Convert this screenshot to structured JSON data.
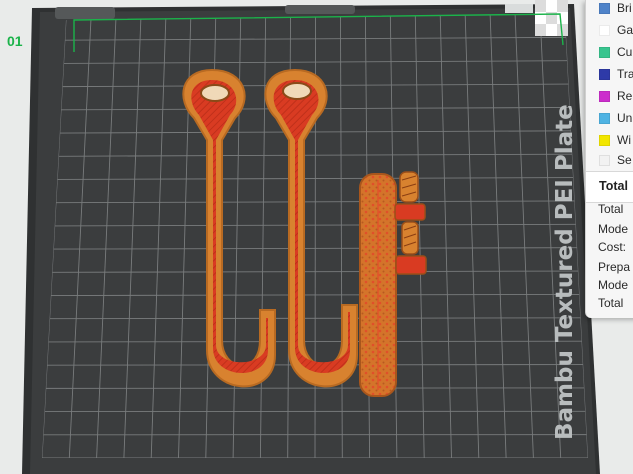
{
  "plate": {
    "label": "Bambu Textured PEI Plate",
    "number": "01"
  },
  "legend": {
    "items": [
      {
        "label": "Bri",
        "color": "#4f83c9"
      },
      {
        "label": "Ga",
        "color": "#ffffff"
      },
      {
        "label": "Cu",
        "color": "#38c58f"
      },
      {
        "label": "Tra",
        "color": "#2e3aa8"
      },
      {
        "label": "Re",
        "color": "#cc2ecc"
      },
      {
        "label": "Un",
        "color": "#4fb3e3"
      },
      {
        "label": "Wi",
        "color": "#f2e600"
      },
      {
        "label": "Se",
        "color": "#f2f2f2"
      }
    ]
  },
  "stats": {
    "header": "Total",
    "rows": [
      "Total",
      "Mode",
      "Cost:",
      "Prepa",
      "Mode",
      "Total"
    ]
  },
  "colors": {
    "plate": "#3b3d3e",
    "grid": "#8e9192",
    "model_fill": "#d93b22",
    "model_wall": "#d8822f",
    "hinge": "#1bb34a"
  }
}
